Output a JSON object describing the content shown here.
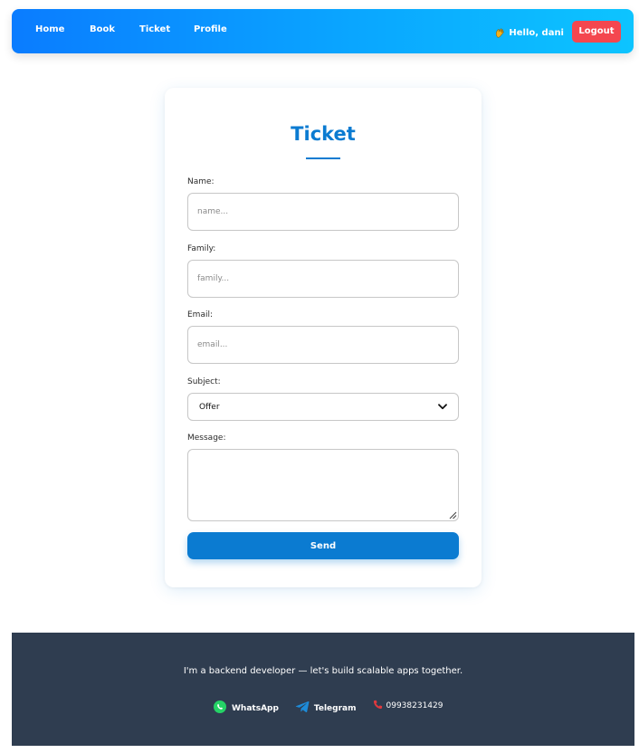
{
  "nav": {
    "links": [
      {
        "label": "Home"
      },
      {
        "label": "Book"
      },
      {
        "label": "Ticket"
      },
      {
        "label": "Profile"
      }
    ],
    "greeting": "Hello, dani",
    "logout_label": "Logout",
    "greeting_icon": "wave-icon"
  },
  "form": {
    "title": "Ticket",
    "name_label": "Name:",
    "name_placeholder": "name...",
    "family_label": "Family:",
    "family_placeholder": "family...",
    "email_label": "Email:",
    "email_placeholder": "email...",
    "subject_label": "Subject:",
    "subject_value": "Offer",
    "message_label": "Message:",
    "message_value": "",
    "send_label": "Send"
  },
  "footer": {
    "tagline": "I'm a backend developer — let's build scalable apps together.",
    "whatsapp_label": "WhatsApp",
    "telegram_label": "Telegram",
    "phone": "09938231429"
  },
  "colors": {
    "nav_gradient_start": "#0a7cff",
    "nav_gradient_end": "#0dc4ff",
    "accent": "#0b7bd1",
    "logout": "#f4474f",
    "footer_bg": "#2f3d50",
    "whatsapp": "#25d366",
    "telegram": "#1d8bd8"
  }
}
